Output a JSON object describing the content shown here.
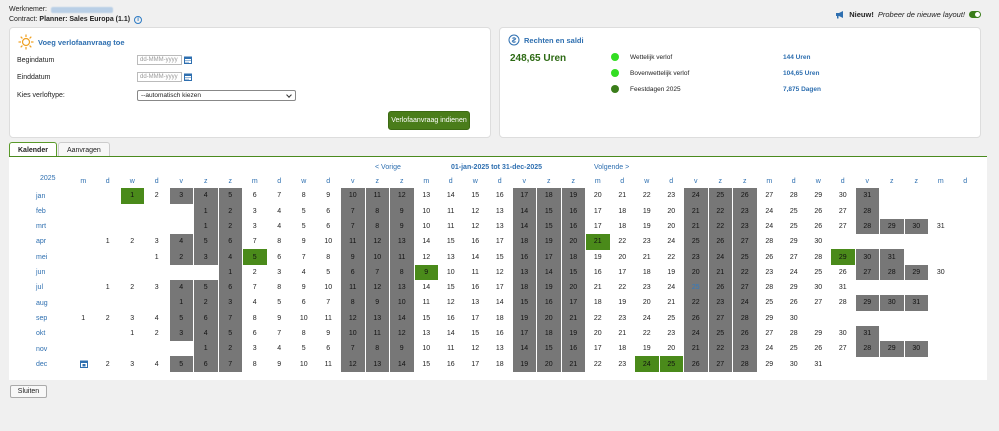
{
  "header": {
    "werknemer_label": "Werknemer:",
    "contract_label": "Contract:",
    "contract_value": "Planner: Sales Europa (1.1)",
    "nieuw_label": "Nieuw!",
    "nieuw_text": "Probeer de nieuwe layout!"
  },
  "request_panel": {
    "title": "Voeg verlofaanvraag toe",
    "begindatum_label": "Begindatum",
    "einddatum_label": "Einddatum",
    "date_placeholder": "dd-MMM-yyyy",
    "type_label": "Kies verloftype:",
    "type_selected": "--automatisch kiezen",
    "submit_label": "Verlofaanvraag indienen"
  },
  "rights_panel": {
    "title": "Rechten en saldi",
    "total": "248,65 Uren",
    "rows": [
      {
        "name": "Wettelijk verlof",
        "value": "144 Uren",
        "color": "#33dd22"
      },
      {
        "name": "Bovenwettelijk verlof",
        "value": "104,65 Uren",
        "color": "#33dd22"
      },
      {
        "name": "Feestdagen 2025",
        "value": "7,875 Dagen",
        "color": "#3a7d1a"
      }
    ]
  },
  "tabs": [
    {
      "label": "Kalender",
      "active": true
    },
    {
      "label": "Aanvragen",
      "active": false
    }
  ],
  "calendar": {
    "year": "2025",
    "prev_label": "< Vorige",
    "range_label": "01-jan-2025 tot 31-dec-2025",
    "next_label": "Volgende >",
    "weekday_headers": [
      "m",
      "d",
      "w",
      "d",
      "v",
      "z",
      "z",
      "m",
      "d",
      "w",
      "d",
      "v",
      "z",
      "z",
      "m",
      "d",
      "w",
      "d",
      "v",
      "z",
      "z",
      "m",
      "d",
      "w",
      "d",
      "v",
      "z",
      "z",
      "m",
      "d",
      "w",
      "d",
      "v",
      "z",
      "z",
      "m",
      "d"
    ],
    "months": [
      {
        "name": "jan",
        "days": 31,
        "offset": 2,
        "holidays": [
          1
        ],
        "today": null
      },
      {
        "name": "feb",
        "days": 28,
        "offset": 5,
        "holidays": [],
        "today": null
      },
      {
        "name": "mrt",
        "days": 31,
        "offset": 5,
        "holidays": [],
        "today": null
      },
      {
        "name": "apr",
        "days": 30,
        "offset": 1,
        "holidays": [
          21
        ],
        "today": null
      },
      {
        "name": "mei",
        "days": 31,
        "offset": 3,
        "holidays": [
          5,
          29
        ],
        "today": null
      },
      {
        "name": "jun",
        "days": 30,
        "offset": 6,
        "holidays": [
          9
        ],
        "today": null
      },
      {
        "name": "jul",
        "days": 31,
        "offset": 1,
        "holidays": [],
        "today": 25
      },
      {
        "name": "aug",
        "days": 31,
        "offset": 4,
        "holidays": [],
        "today": null
      },
      {
        "name": "sep",
        "days": 30,
        "offset": 0,
        "holidays": [],
        "today": null
      },
      {
        "name": "okt",
        "days": 31,
        "offset": 2,
        "holidays": [],
        "today": null
      },
      {
        "name": "nov",
        "days": 30,
        "offset": 5,
        "holidays": [],
        "today": null
      },
      {
        "name": "dec",
        "days": 31,
        "offset": 0,
        "holidays": [
          24,
          25
        ],
        "today": null
      }
    ]
  },
  "footer": {
    "close_label": "Sluiten"
  }
}
